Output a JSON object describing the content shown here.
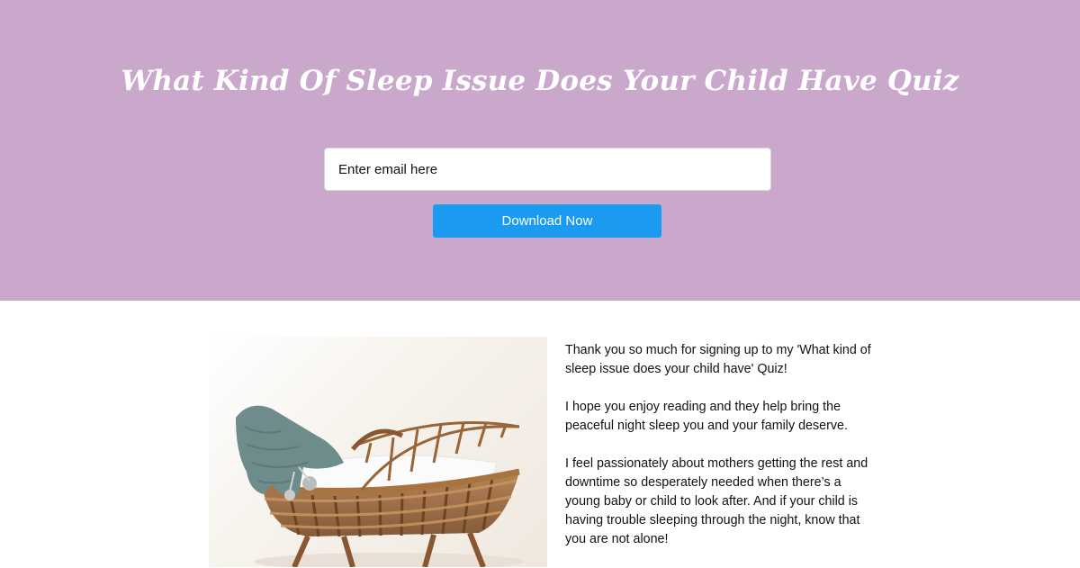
{
  "hero": {
    "title": "What Kind Of Sleep Issue Does Your Child Have Quiz",
    "background": "#c9a8cc"
  },
  "form": {
    "email_placeholder": "Enter email here",
    "button_label": "Download Now",
    "button_color": "#1a9bf0"
  },
  "content": {
    "image": "wicker-bassinet-with-knit-blanket",
    "paragraphs": [
      "Thank you so much for signing up to my 'What kind of sleep issue does your child have' Quiz!",
      "I hope you enjoy reading and they help bring the peaceful night sleep you and your family deserve.",
      "I feel passionately about mothers getting the rest and downtime so desperately needed when there’s a young baby or child to look after.  And if your child is having trouble sleeping through the night, know that you are not alone!"
    ]
  }
}
